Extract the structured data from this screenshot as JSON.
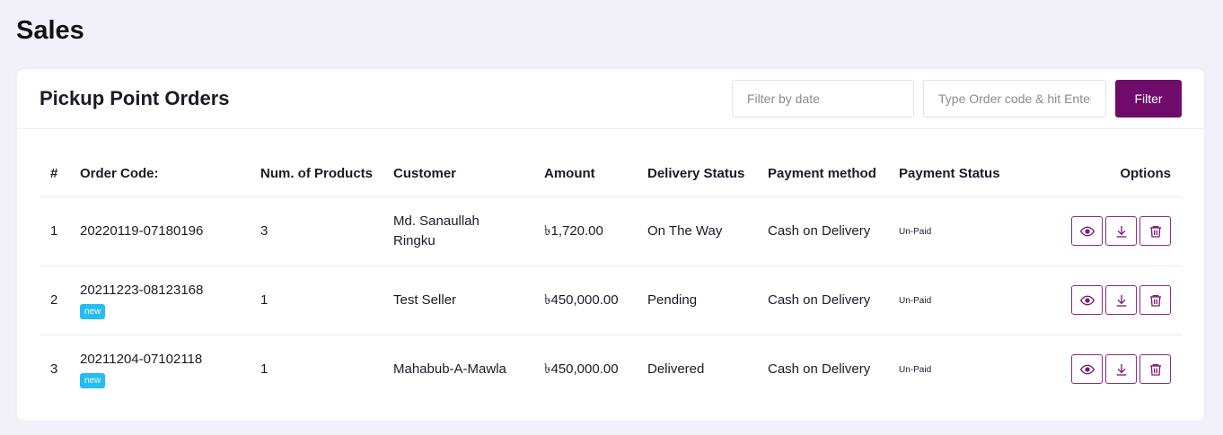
{
  "page": {
    "title": "Sales"
  },
  "card": {
    "title": "Pickup Point Orders",
    "date_filter_placeholder": "Filter by date",
    "search_placeholder": "Type Order code & hit Enter",
    "filter_label": "Filter"
  },
  "table": {
    "headers": [
      "#",
      "Order Code:",
      "Num. of Products",
      "Customer",
      "Amount",
      "Delivery Status",
      "Payment method",
      "Payment Status",
      "Options"
    ],
    "rows": [
      {
        "idx": "1",
        "code": "20220119-07180196",
        "badge": "",
        "products": "3",
        "customer": "Md. Sanaullah Ringku",
        "amount": "৳1,720.00",
        "delivery": "On The Way",
        "payment_method": "Cash on Delivery",
        "payment_status": "Un-Paid"
      },
      {
        "idx": "2",
        "code": "20211223-08123168",
        "badge": "new",
        "products": "1",
        "customer": "Test Seller",
        "amount": "৳450,000.00",
        "delivery": "Pending",
        "payment_method": "Cash on Delivery",
        "payment_status": "Un-Paid"
      },
      {
        "idx": "3",
        "code": "20211204-07102118",
        "badge": "new",
        "products": "1",
        "customer": "Mahabub-A-Mawla",
        "amount": "৳450,000.00",
        "delivery": "Delivered",
        "payment_method": "Cash on Delivery",
        "payment_status": "Un-Paid"
      }
    ]
  },
  "icons": {
    "view": "eye-icon",
    "download": "download-icon",
    "delete": "trash-icon"
  },
  "colors": {
    "accent": "#6f0c6b",
    "badge": "#25bcf1",
    "background": "#f2f0f9"
  }
}
